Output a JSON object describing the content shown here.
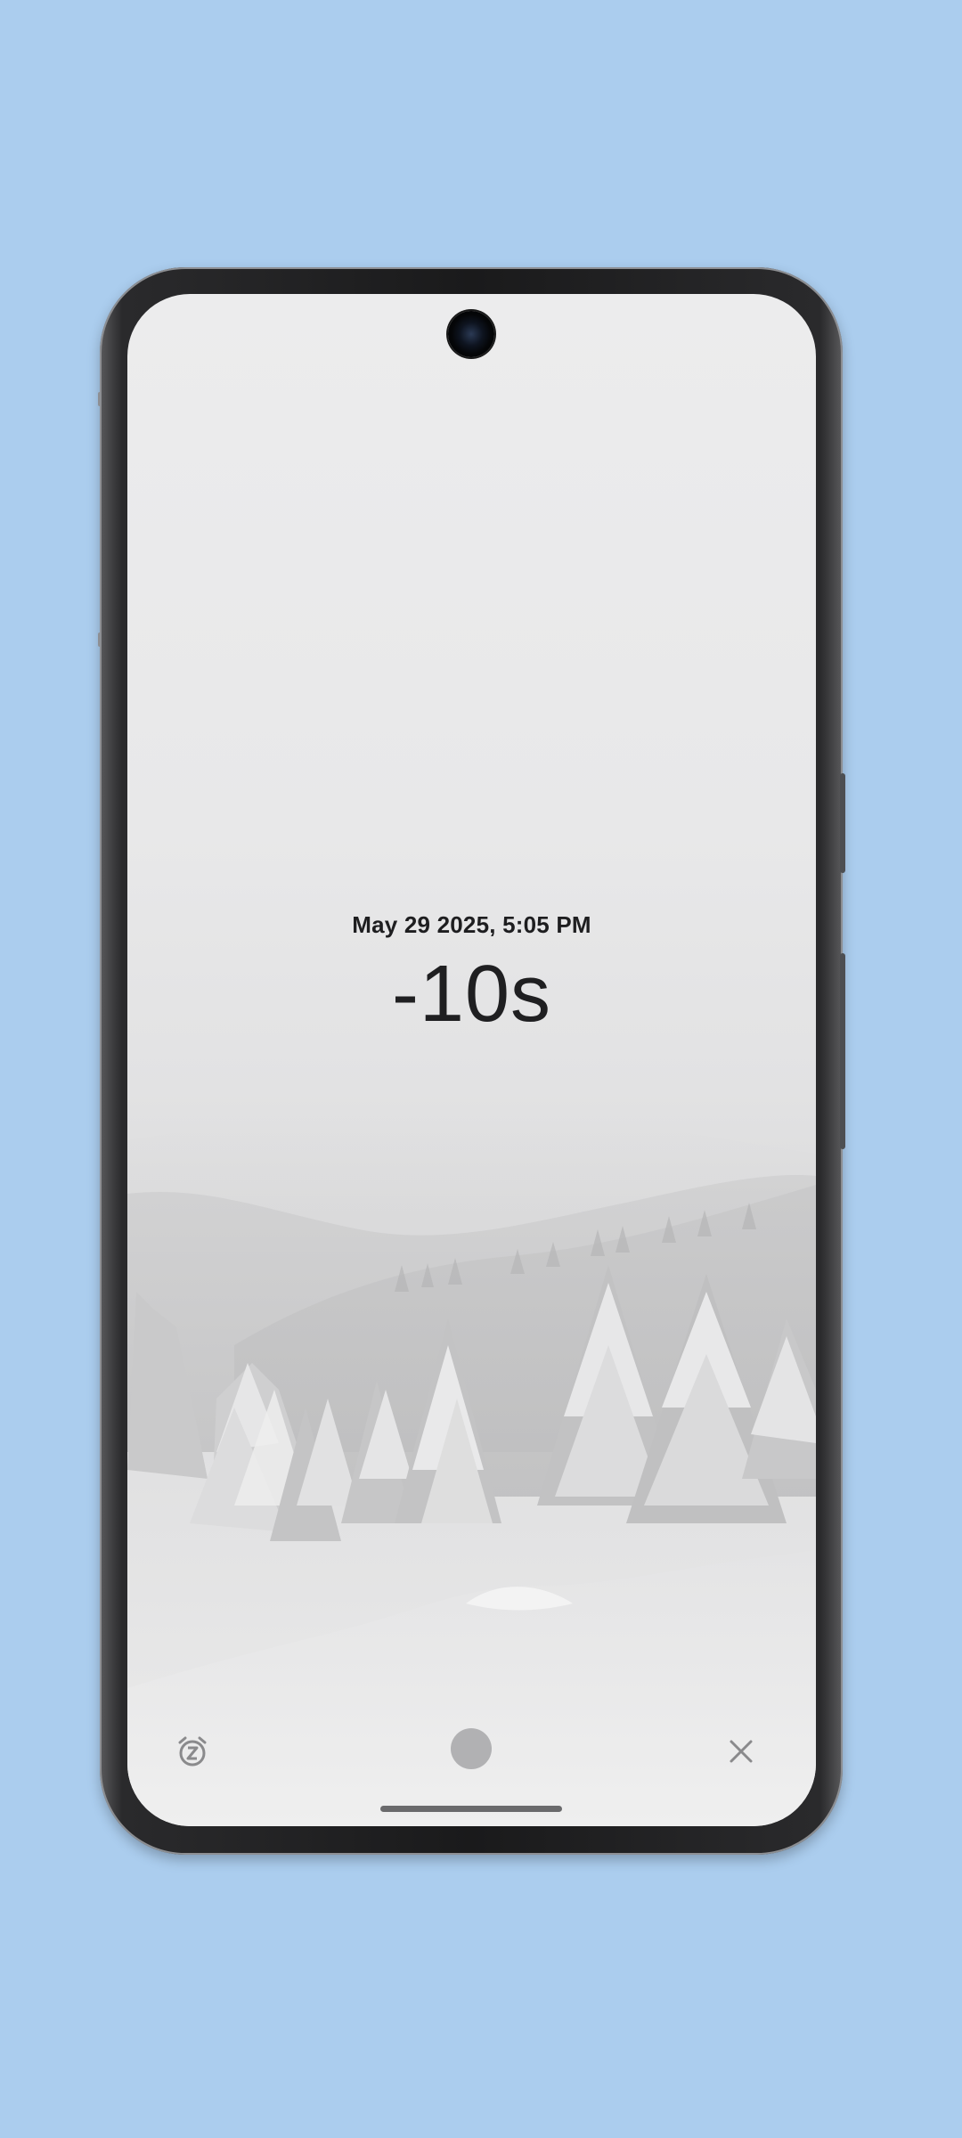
{
  "alarm": {
    "datetime": "May 29 2025, 5:05 PM",
    "countdown": "-10s"
  },
  "actions": {
    "snooze_icon": "alarm-snooze-icon",
    "dismiss_icon": "close-icon",
    "handle": "slide-handle"
  },
  "colors": {
    "background": "#abcdee",
    "text": "#1f1f21",
    "icon": "#8a8a8c",
    "handle": "#b1b1b3"
  }
}
